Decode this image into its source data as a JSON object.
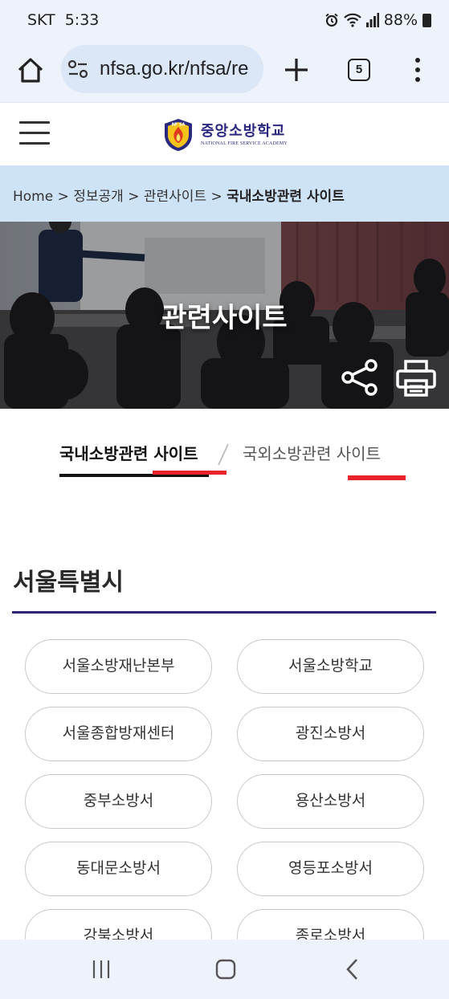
{
  "status_bar": {
    "carrier": "SKT",
    "time": "5:33",
    "battery": "88%",
    "icons": [
      "alarm-icon",
      "wifi-icon",
      "signal-icon",
      "battery-icon"
    ]
  },
  "browser": {
    "url": "nfsa.go.kr/nfsa/re",
    "tab_count": "5"
  },
  "site": {
    "logo_ko": "중앙소방학교",
    "logo_en": "NATIONAL FIRE SERVICE ACADEMY",
    "emblem_text": "NF SA"
  },
  "breadcrumb": {
    "items": [
      "Home",
      "정보공개",
      "관련사이트"
    ],
    "separator": ">",
    "current": "국내소방관련 사이트"
  },
  "hero": {
    "title": "관련사이트"
  },
  "tabs": [
    {
      "label": "국내소방관련 사이트",
      "active": true
    },
    {
      "label": "국외소방관련 사이트",
      "active": false
    }
  ],
  "section": {
    "title": "서울특별시",
    "sites": [
      "서울소방재난본부",
      "서울소방학교",
      "서울종합방재센터",
      "광진소방서",
      "중부소방서",
      "용산소방서",
      "동대문소방서",
      "영등포소방서",
      "강북소방서",
      "종로소방서"
    ]
  },
  "colors": {
    "accent_navy": "#2e2578",
    "breadcrumb_bg": "#cfe3f7",
    "mark_red": "#e8232a",
    "browser_bg": "#eef3fb"
  }
}
